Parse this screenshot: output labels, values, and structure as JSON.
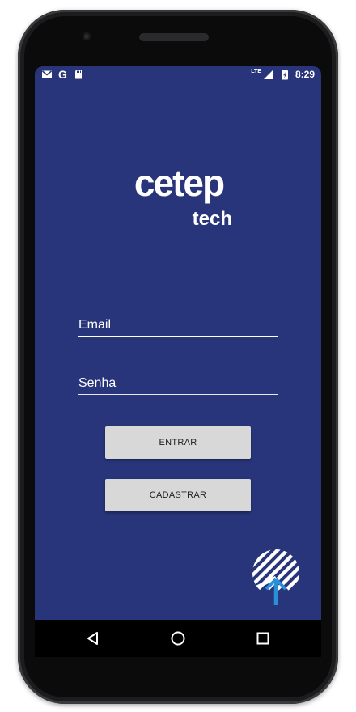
{
  "status_bar": {
    "left_icons": [
      "gmail-icon",
      "google-icon",
      "sd-card-icon"
    ],
    "google_letter": "G",
    "network_label": "LTE",
    "time": "8:29"
  },
  "logo": {
    "line1": "cetep",
    "line2": "tech"
  },
  "login_form": {
    "email_placeholder": "Email",
    "password_placeholder": "Senha",
    "enter_label": "ENTRAR",
    "register_label": "CADASTRAR"
  },
  "colors": {
    "background": "#28357a",
    "button": "#d8d8d8",
    "fab_accent": "#2a8fd8"
  },
  "nav_bar": {
    "icons": [
      "back-icon",
      "home-icon",
      "recent-apps-icon"
    ]
  }
}
